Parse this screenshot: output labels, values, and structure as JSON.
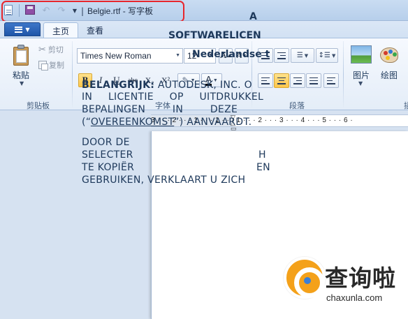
{
  "titlebar": {
    "separator": "|",
    "title": "Belgie.rtf - 写字板"
  },
  "tabs": [
    {
      "label": "主页",
      "active": true
    },
    {
      "label": "查看",
      "active": false
    }
  ],
  "ribbon": {
    "clipboard": {
      "paste_label": "粘贴",
      "cut_label": "剪切",
      "copy_label": "复制",
      "group_label": "剪贴板"
    },
    "font": {
      "font_name": "Times New Roman",
      "font_size": "12",
      "grow_glyph": "A",
      "shrink_glyph": "A",
      "bold_glyph": "B",
      "italic_glyph": "I",
      "underline_glyph": "U",
      "strike_glyph": "abe",
      "subscript_glyph": "X₂",
      "superscript_glyph": "X²",
      "font_color_glyph": "A",
      "group_label": "字体",
      "bold_active": true
    },
    "paragraph": {
      "group_label": "段落",
      "alignment": "center"
    },
    "insert": {
      "picture_label": "图片",
      "paint_label": "绘图",
      "group_label_partial": "插"
    }
  },
  "ruler": {
    "text": "3 · · · 2 · · · 1 · · · 1 · · · 1 · · · 2 · · · 3 · · · 4 · · · 5 · · · 6 ·"
  },
  "document": {
    "line1": "A",
    "line2": "SOFTWARELICEN",
    "line3": "Nederlandse t",
    "para1": [
      {
        "bold": "BELANGRIJK:",
        "text": " AUTODESK, INC. O"
      },
      {
        "text": "IN LICENTIE OP UITDRUKKEL"
      },
      {
        "text": "BEPALINGEN IN DEZE"
      },
      {
        "pre": "(“",
        "underlined": "OVEREENKOMST",
        "post": "”) AANVAARDT."
      }
    ],
    "para2": [
      "DOOR DE",
      "SELECTER",
      "TE KOPIËR",
      "GEBRUIKEN, VERKLAART U ZICH"
    ],
    "para2_tails": [
      "H",
      "EN"
    ]
  },
  "watermark": {
    "brand_cn": "查询啦",
    "url": "chaxunla.com"
  }
}
